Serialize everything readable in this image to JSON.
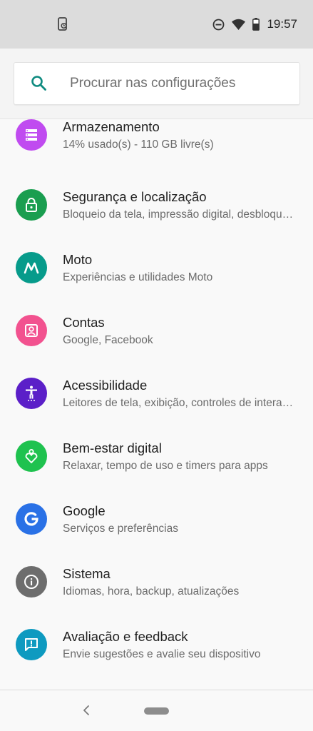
{
  "status_bar": {
    "time": "19:57",
    "icons": [
      "phone-sync-icon",
      "do-not-disturb-icon",
      "wifi-icon",
      "battery-icon"
    ]
  },
  "search": {
    "placeholder": "Procurar nas configurações"
  },
  "settings": [
    {
      "title": "Armazenamento",
      "subtitle": "14% usado(s) - 110 GB livre(s)",
      "icon": "storage-icon",
      "color": "#c04bf0"
    },
    {
      "title": "Segurança e localização",
      "subtitle": "Bloqueio da tela, impressão digital, desbloqueio facial",
      "icon": "lock-icon",
      "color": "#1a9e50"
    },
    {
      "title": "Moto",
      "subtitle": "Experiências e utilidades Moto",
      "icon": "moto-icon",
      "color": "#079b8b"
    },
    {
      "title": "Contas",
      "subtitle": "Google, Facebook",
      "icon": "account-icon",
      "color": "#f2528f"
    },
    {
      "title": "Acessibilidade",
      "subtitle": "Leitores de tela, exibição, controles de interação",
      "icon": "accessibility-icon",
      "color": "#5b1fc8"
    },
    {
      "title": "Bem-estar digital",
      "subtitle": "Relaxar, tempo de uso e timers para apps",
      "icon": "wellbeing-icon",
      "color": "#1fc24f"
    },
    {
      "title": "Google",
      "subtitle": "Serviços e preferências",
      "icon": "google-icon",
      "color": "#2a71e6"
    },
    {
      "title": "Sistema",
      "subtitle": "Idiomas, hora, backup, atualizações",
      "icon": "info-icon",
      "color": "#6d6d6d"
    },
    {
      "title": "Avaliação e feedback",
      "subtitle": "Envie sugestões e avalie seu dispositivo",
      "icon": "feedback-icon",
      "color": "#0e9ac0"
    }
  ]
}
